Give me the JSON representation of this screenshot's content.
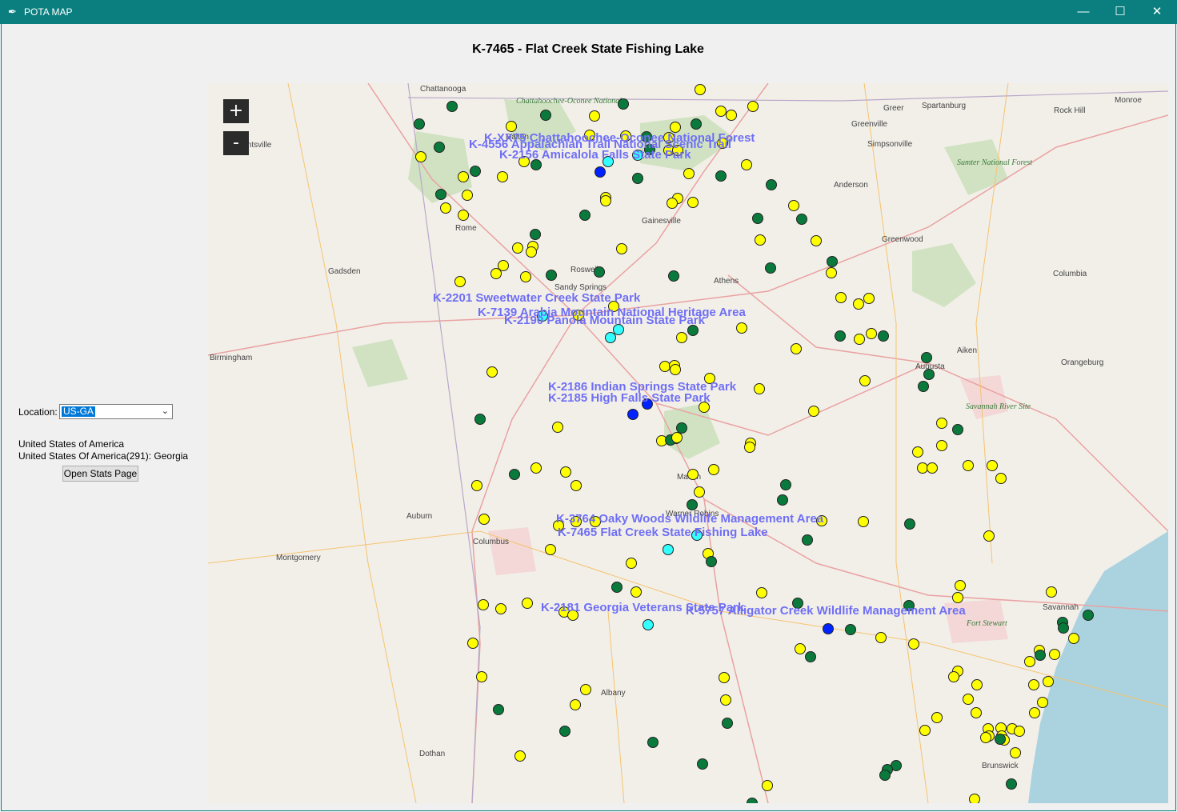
{
  "window": {
    "title": "POTA MAP",
    "app_icon": "feather-icon",
    "controls": {
      "minimize": "—",
      "maximize": "☐",
      "close": "✕"
    }
  },
  "header": {
    "title": "K-7465 - Flat Creek State Fishing Lake"
  },
  "sidebar": {
    "location_label": "Location:",
    "location_value": "US-GA",
    "country": "United States of America",
    "region": "United States Of America(291): Georgia",
    "stats_button": "Open Stats Page"
  },
  "map": {
    "zoom_in": "+",
    "zoom_out": "-",
    "colors": {
      "yellow_marker": "#ffff00",
      "green_marker": "#0a7a3c",
      "cyan_marker": "#33ffff",
      "blue_marker": "#0022ff",
      "label": "#6f6ff5",
      "water": "#aad3df"
    },
    "cities": [
      "Chattanooga",
      "Huntsville",
      "Dalton",
      "Rome",
      "Gadsden",
      "Birmingham",
      "Gainesville",
      "Roswell",
      "Sandy Springs",
      "Athens",
      "Anderson",
      "Greenville",
      "Spartanburg",
      "Greer",
      "Simpsonville",
      "Rock Hill",
      "Monroe",
      "Greenwood",
      "Columbia",
      "Aiken",
      "Augusta",
      "Orangeburg",
      "Auburn",
      "Columbus",
      "Montgomery",
      "Macon",
      "Warner Robins",
      "Albany",
      "Dothan",
      "Savannah",
      "Brunswick"
    ],
    "green_areas": [
      "Chattahoochee-Oconee National",
      "Sumter National Forest",
      "Savannah River Site",
      "Fort Stewart"
    ],
    "park_labels": [
      "K-XX75 Chattahoochee-Oconee National Forest",
      "K-4556 Appalachian Trail National Scenic Trail",
      "K-2156 Amicalola Falls State Park",
      "K-2201 Sweetwater Creek State Park",
      "K-7139 Arabia Mountain National Heritage Area",
      "K-2190 Panola Mountain State Park",
      "K-2186 Indian Springs State Park",
      "K-2185 High Falls State Park",
      "K-3764 Oaky Woods Wildlife Management Area",
      "K-7465 Flat Creek State Fishing Lake",
      "K-2181 Georgia Veterans State Park",
      "K-5757 Alligator Creek Wildlife Management Area"
    ]
  }
}
